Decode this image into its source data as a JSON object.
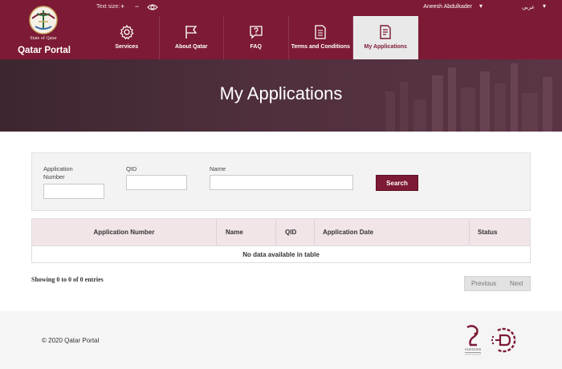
{
  "header": {
    "portal_title": "Qatar Portal",
    "emblem_text": "State of Qatar",
    "text_size_label": "Text size:",
    "text_size_increase": "+",
    "text_size_decrease": "−",
    "user_name": "Aneesh Abdulkader",
    "language_toggle": "عربي",
    "brand_color": "#7d1a35"
  },
  "nav": {
    "items": [
      {
        "label": "Services",
        "icon": "gear-icon"
      },
      {
        "label": "About Qatar",
        "icon": "flag-icon"
      },
      {
        "label": "FAQ",
        "icon": "question-icon"
      },
      {
        "label": "Terms and Conditions",
        "icon": "document-icon"
      },
      {
        "label": "My Applications",
        "icon": "applications-icon",
        "active": true
      }
    ]
  },
  "banner": {
    "title": "My Applications"
  },
  "filter": {
    "app_number_label": "Application Number",
    "qid_label": "QID",
    "name_label": "Name",
    "app_number_value": "",
    "qid_value": "",
    "name_value": "",
    "search_label": "Search"
  },
  "table": {
    "columns": [
      "Application Number",
      "Name",
      "QID",
      "Application Date",
      "Status"
    ],
    "empty_message": "No data available in table"
  },
  "pagination": {
    "info": "Showing 0 to 0 of 0 entries",
    "previous_label": "Previous",
    "next_label": "Next"
  },
  "footer": {
    "copyright": "© 2020 Qatar Portal",
    "hukoomi_text": "HUKOOMI"
  }
}
